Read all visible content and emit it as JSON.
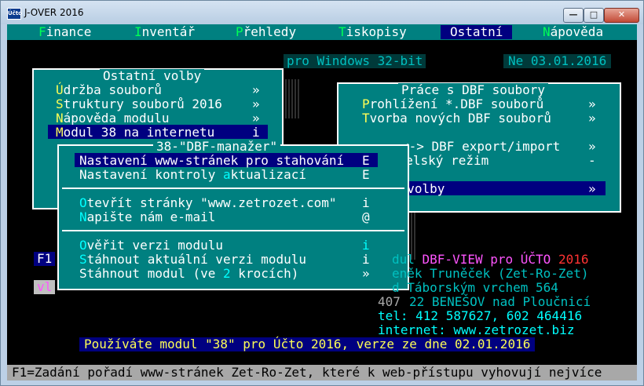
{
  "window": {
    "icon_text": "Účto",
    "title": "J-OVER 2016"
  },
  "menu": [
    {
      "hk": "F",
      "rest": "inance"
    },
    {
      "hk": "I",
      "rest": "nventář"
    },
    {
      "hk": "P",
      "rest": "řehledy"
    },
    {
      "hk": "T",
      "rest": "iskopisy"
    },
    {
      "hk": "",
      "rest": "Ostatní",
      "active": true
    },
    {
      "hk": "N",
      "rest": "ápověda"
    }
  ],
  "info": {
    "platform": "pro Windows 32-bit",
    "date": "Ne 03.01.2016"
  },
  "ostatni_volby": {
    "title": "Ostatní volby",
    "items": [
      {
        "hk": "Ú",
        "rest": "držba souborů",
        "mark": "»"
      },
      {
        "hk": "S",
        "rest": "truktury souborů 2016",
        "mark": "»"
      },
      {
        "hk": "N",
        "rest": "ápověda modulu",
        "mark": "»"
      },
      {
        "hk": "M",
        "rest": "odul 38 na internetu",
        "mark": "i"
      }
    ]
  },
  "dbf_box": {
    "title": "Práce s DBF soubory",
    "items": [
      {
        "hk": "P",
        "rest": "rohlížení *.DBF souborů",
        "mark": "»"
      },
      {
        "hk": "T",
        "rest": "vorba nových DBF souborů",
        "mark": "»"
      },
      {
        "text": "<-> DBF export/import",
        "mark": "»"
      },
      {
        "text": "atelský režim",
        "hk_pos": "",
        "mark": "-"
      },
      {
        "text": "í volby",
        "mark": "»"
      }
    ]
  },
  "dbf_manager": {
    "title": "38-\"DBF-manažer\"",
    "items": [
      {
        "text": "Nastavení www-stránek pro stahování",
        "mark": "E"
      },
      {
        "pre": "Nastavení kontroly ",
        "hk": "a",
        "rest": "ktualizací",
        "mark": "E"
      },
      {
        "hk": "O",
        "rest": "tevřít stránky \"www.zetrozet.com\"",
        "mark": "i"
      },
      {
        "hk": "N",
        "rest": "apište nám e-mail",
        "mark": "@"
      },
      {
        "hk": "O",
        "rest": "věřit verzi modulu",
        "mark": "i"
      },
      {
        "hk": "S",
        "rest": "táhnout aktuální verzi modulu",
        "mark": "i"
      },
      {
        "pre": "Stáhnout modul (ve ",
        "hk": "2",
        "rest": " krocích)",
        "mark": "»"
      }
    ]
  },
  "left_fragments": {
    "f1": "F1",
    "vl": "vl"
  },
  "about": {
    "line1_pre": "dul ",
    "line1_mag": "DBF-VIEW pro ÚČTO",
    "line1_year": "2016",
    "line2": "eněk Truněček (Zet-Ro-Zet)",
    "line3": "d Táborským vrchem 564",
    "line4_pre": "407",
    "line4": "22 BENEŠOV nad Ploučnicí",
    "line5": "tel: 412 587627, 602 464416",
    "line6": "internet: www.zetrozet.biz"
  },
  "version_line": "Používáte modul \"38\" pro Účto 2016, verze ze dne 02.01.2016",
  "status_bar": "F1=Zadání pořadí www-stránek Zet-Ro-Zet, které k web-přístupu vyhovují nejvíce"
}
